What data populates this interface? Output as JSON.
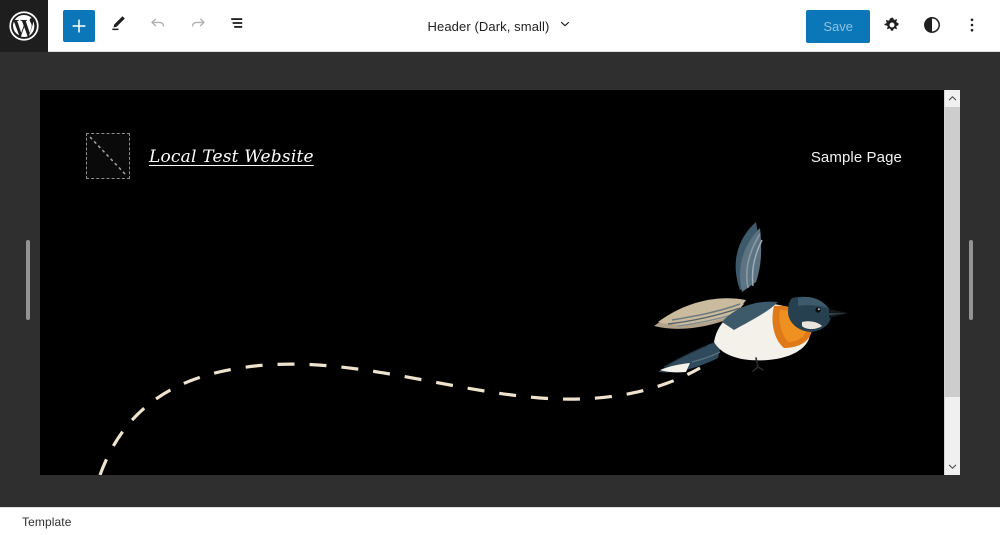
{
  "app": {
    "name": "WordPress Site Editor",
    "logo_icon": "wordpress-logo-icon"
  },
  "toolbar": {
    "add_block": {
      "label": "+",
      "icon": "plus-icon",
      "title": "Add block",
      "color": "#0b76b8"
    },
    "edit_tool": {
      "icon": "pencil-icon",
      "title": "Edit"
    },
    "undo": {
      "icon": "undo-arrow-icon",
      "title": "Undo",
      "state": "disabled"
    },
    "redo": {
      "icon": "redo-arrow-icon",
      "title": "Redo",
      "state": "disabled"
    },
    "list_view": {
      "icon": "list-view-icon",
      "title": "Document Overview"
    }
  },
  "document": {
    "title": "Header (Dark, small)",
    "chevron_icon": "chevron-down-icon"
  },
  "actions": {
    "save_label": "Save",
    "save_state": "disabled",
    "settings": {
      "icon": "gear-icon",
      "title": "Settings"
    },
    "styles": {
      "icon": "contrast-half-circle-icon",
      "title": "Styles"
    },
    "options": {
      "icon": "vertical-dots-icon",
      "title": "Options"
    }
  },
  "canvas": {
    "background": "#000000",
    "site_logo": {
      "icon": "image-placeholder-icon",
      "alt": "Site Logo placeholder"
    },
    "site_title": "Local Test Website",
    "nav": [
      {
        "label": "Sample Page"
      }
    ],
    "artwork": {
      "name": "flying-bird-illustration",
      "trail": "dashed-curve-trail",
      "trail_color": "#efe3cd",
      "bird_colors": {
        "head_wing": "#2f4a5c",
        "breast": "#e07a18",
        "belly": "#f2efe8",
        "beak": "#1a1a1a",
        "wing_highlight": "#a89478"
      }
    }
  },
  "resize": {
    "left_handle": "canvas-resize-handle-left",
    "right_handle": "canvas-resize-handle-right"
  },
  "scrollbar": {
    "up_icon": "chevron-up-icon",
    "down_icon": "chevron-down-icon",
    "thumb": "scrollbar-thumb"
  },
  "statusbar": {
    "label": "Template"
  }
}
